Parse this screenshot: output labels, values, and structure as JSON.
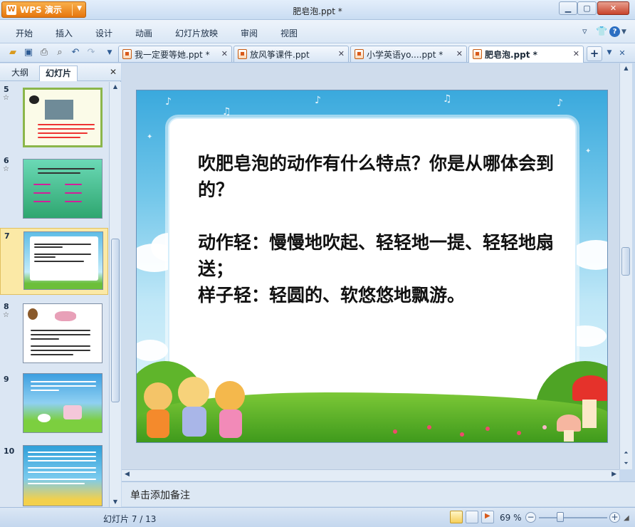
{
  "app": {
    "name": "WPS 演示",
    "window_title": "肥皂泡.ppt *"
  },
  "menu": {
    "items": [
      "开始",
      "插入",
      "设计",
      "动画",
      "幻灯片放映",
      "审阅",
      "视图"
    ]
  },
  "doc_tabs": [
    {
      "label": "我一定要等她.ppt *"
    },
    {
      "label": "放风筝课件.ppt"
    },
    {
      "label": "小学英语yo....ppt *"
    },
    {
      "label": "肥皂泡.ppt *"
    }
  ],
  "left_panel": {
    "tabs": [
      "大纲",
      "幻灯片"
    ],
    "slides": [
      {
        "num": "5"
      },
      {
        "num": "6"
      },
      {
        "num": "7"
      },
      {
        "num": "8"
      },
      {
        "num": "9"
      },
      {
        "num": "10"
      }
    ]
  },
  "slide": {
    "question": "吹肥皂泡的动作有什么特点？你是从哪体会到的？",
    "answer_1": "动作轻：慢慢地吹起、轻轻地一提、轻轻地扇送；",
    "answer_2": "样子轻：轻圆的、软悠悠地飘游。"
  },
  "notes": {
    "placeholder": "单击添加备注"
  },
  "status": {
    "slide_position": "幻灯片 7 / 13",
    "zoom": "69 %",
    "zoom_level": 0.31
  },
  "colors": {
    "app_button": "#e6760e",
    "selected_slide": "#fbe9a6",
    "slide_sky": "#3aa9dd",
    "grass": "#3f9a1c"
  }
}
